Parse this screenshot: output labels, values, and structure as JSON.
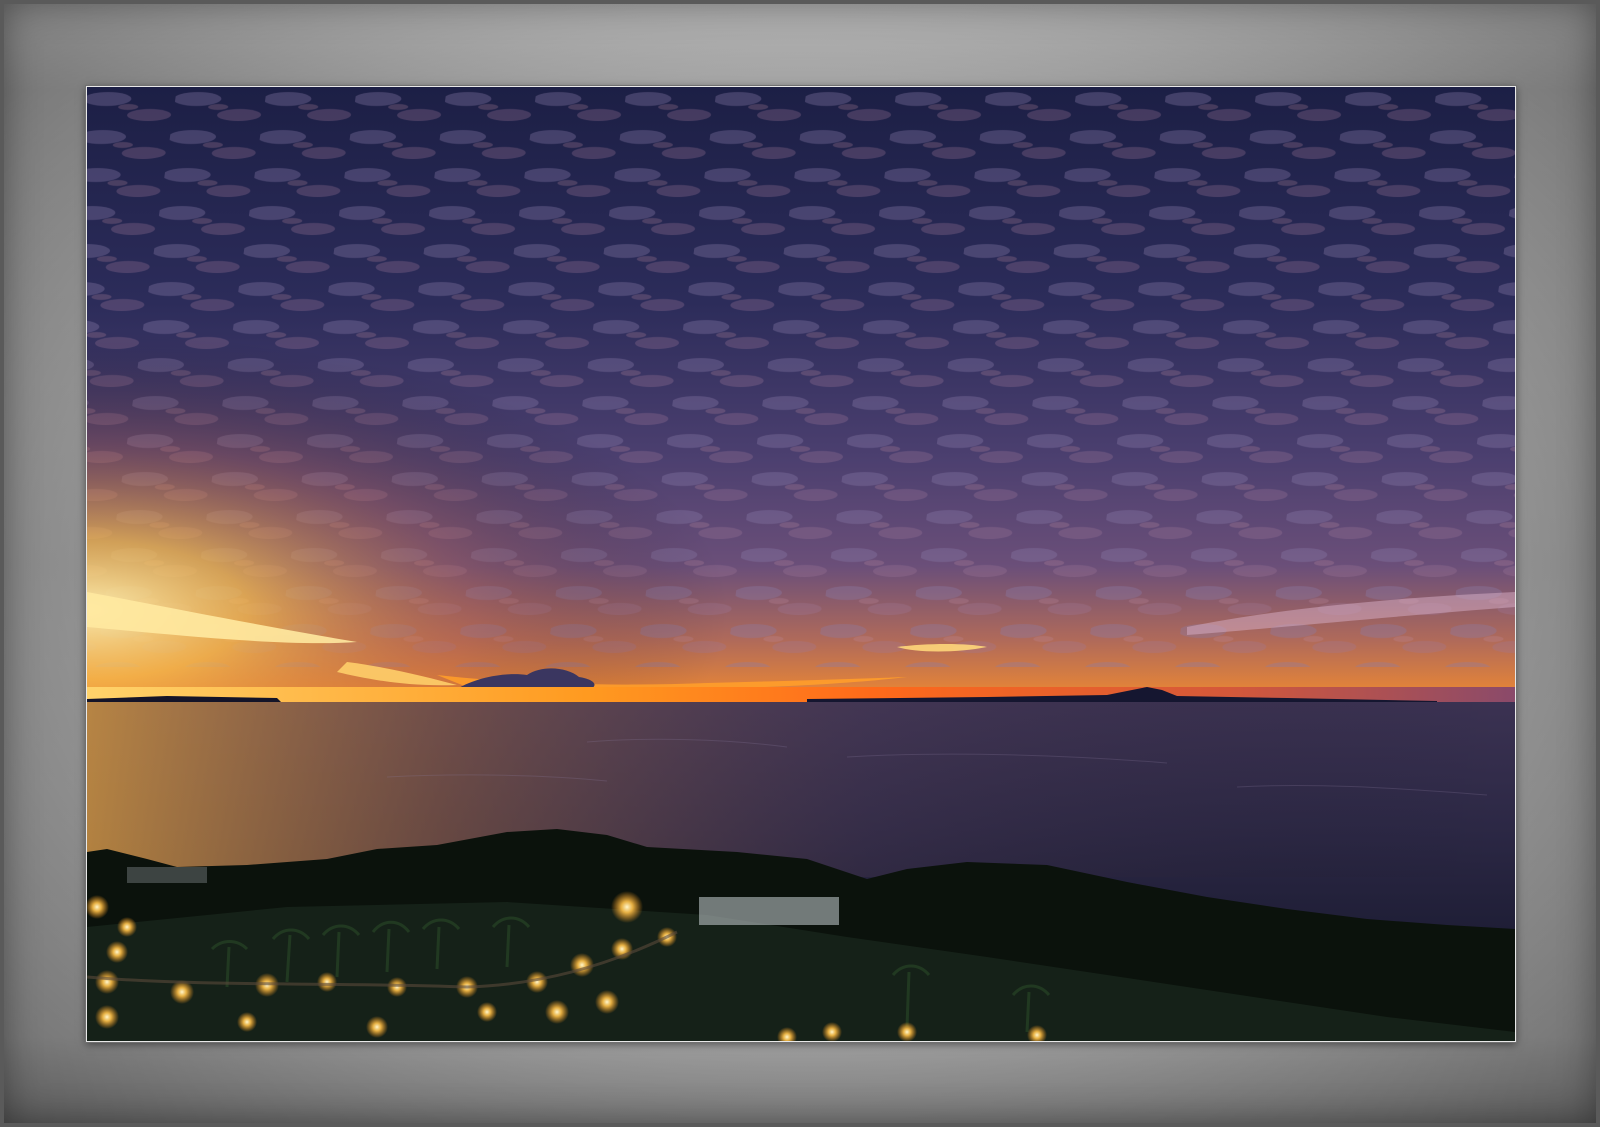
{
  "scene": {
    "subject": "sunset-over-sea-with-altocumulus-clouds",
    "colors": {
      "frame_outer": "#6e6e6e",
      "mat": "#a9a9a9",
      "sky_top": "#1e2147",
      "sky_mid": "#4a3f6e",
      "horizon_glow": "#ff9a1f",
      "sea": "#2e2a48",
      "land": "#0d140f",
      "lights": "#ffd27a"
    }
  }
}
